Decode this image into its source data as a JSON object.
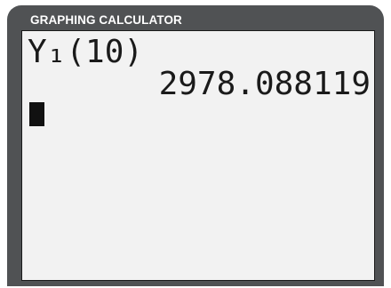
{
  "header": {
    "title": "GRAPHING CALCULATOR"
  },
  "screen": {
    "entry": "Y₁(10)",
    "result": "2978.088119"
  },
  "colors": {
    "frame": "#505254",
    "screen_bg": "#f2f2f2",
    "text": "#1a1a1a"
  }
}
